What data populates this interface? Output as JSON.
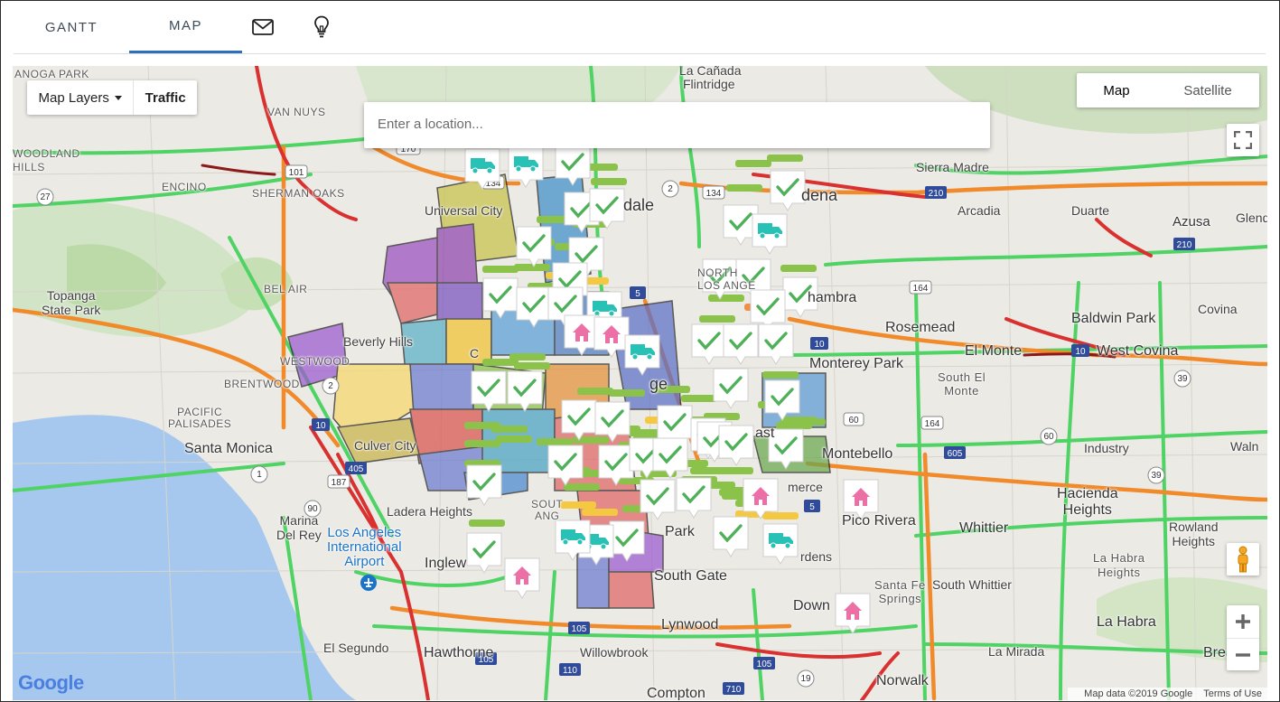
{
  "tabs": [
    {
      "label": "GANTT",
      "active": false
    },
    {
      "label": "MAP",
      "active": true
    },
    {
      "icon": "envelope-icon"
    },
    {
      "icon": "lightbulb-icon"
    }
  ],
  "map": {
    "layers_label": "Map Layers",
    "traffic_label": "Traffic",
    "search_placeholder": "Enter a location...",
    "type_map": "Map",
    "type_satellite": "Satellite",
    "attribution": "Map data ©2019 Google",
    "terms": "Terms of Use",
    "logo": "Google",
    "labels": {
      "canoga_park": "ANOGA PARK",
      "la_canada": "La Cañada",
      "flintridge": "Flintridge",
      "van_nuys": "VAN NUYS",
      "woodland_hills": "WOODLAND\nHILLS",
      "encino": "ENCINO",
      "sherman_oaks": "SHERMAN OAKS",
      "universal_city": "Universal City",
      "glendale": "dale",
      "pasadena": "dena",
      "sierra_madre": "Sierra Madre",
      "arcadia": "Arcadia",
      "duarte": "Duarte",
      "azusa": "Azusa",
      "glendora": "Glend",
      "topanga": "Topanga\nState Park",
      "bel_air": "BEL AIR",
      "beverly_hills": "Beverly Hills",
      "westwood": "WESTWOOD",
      "brentwood": "BRENTWOOD",
      "north_los_angeles": "NORTH\nLOS ANGE",
      "alhambra": "hambra",
      "rosemead": "Rosemead",
      "baldwin_park": "Baldwin Park",
      "covina": "Covina",
      "el_monte": "El Monte",
      "west_covina": "West Covina",
      "monterey_park": "Monterey Park",
      "south_el_monte": "South El\nMonte",
      "pacific_palisades": "PACIFIC\nPALISADES",
      "santa_monica": "Santa Monica",
      "culver_city": "Culver City",
      "montebello": "Montebello",
      "industry": "Industry",
      "walnut": "Waln",
      "hacienda_heights": "Hacienda\nHeights",
      "ladera_heights": "Ladera Heights",
      "marina_del_rey": "Marina\nDel Rey",
      "lax": "Los Angeles\nInternational\nAirport",
      "inglewood": "Inglew",
      "pico_rivera": "Pico Rivera",
      "whittier": "Whittier",
      "rowland_heights": "Rowland\nHeights",
      "south_gate": "South Gate",
      "santa_fe_springs": "Santa Fe\nSprings",
      "south_whittier": "South Whittier",
      "la_habra_heights": "La Habra\nHeights",
      "downey": "Down",
      "la_habra": "La Habra",
      "el_segundo": "El Segundo",
      "hawthorne": "Hawthorne",
      "willowbrook": "Willowbrook",
      "lynwood": "Lynwood",
      "la_mirada": "La Mirada",
      "brea": "Brea",
      "compton": "Compton",
      "norwalk": "Norwalk",
      "commerce": "merce",
      "bell_gardens": "rdens",
      "huntington_park": "Park",
      "east_la": "ast",
      "los_angeles": "ge",
      "south_la": "SOUT",
      "south_la2": "ANG",
      "city": "C"
    },
    "shields": [
      "170",
      "134",
      "2",
      "134",
      "210",
      "101",
      "27",
      "5",
      "164",
      "10",
      "10",
      "2",
      "10",
      "60",
      "164",
      "605",
      "60",
      "39",
      "1",
      "405",
      "187",
      "90",
      "5",
      "39",
      "105",
      "105",
      "110",
      "710",
      "19",
      "105",
      "210"
    ]
  }
}
